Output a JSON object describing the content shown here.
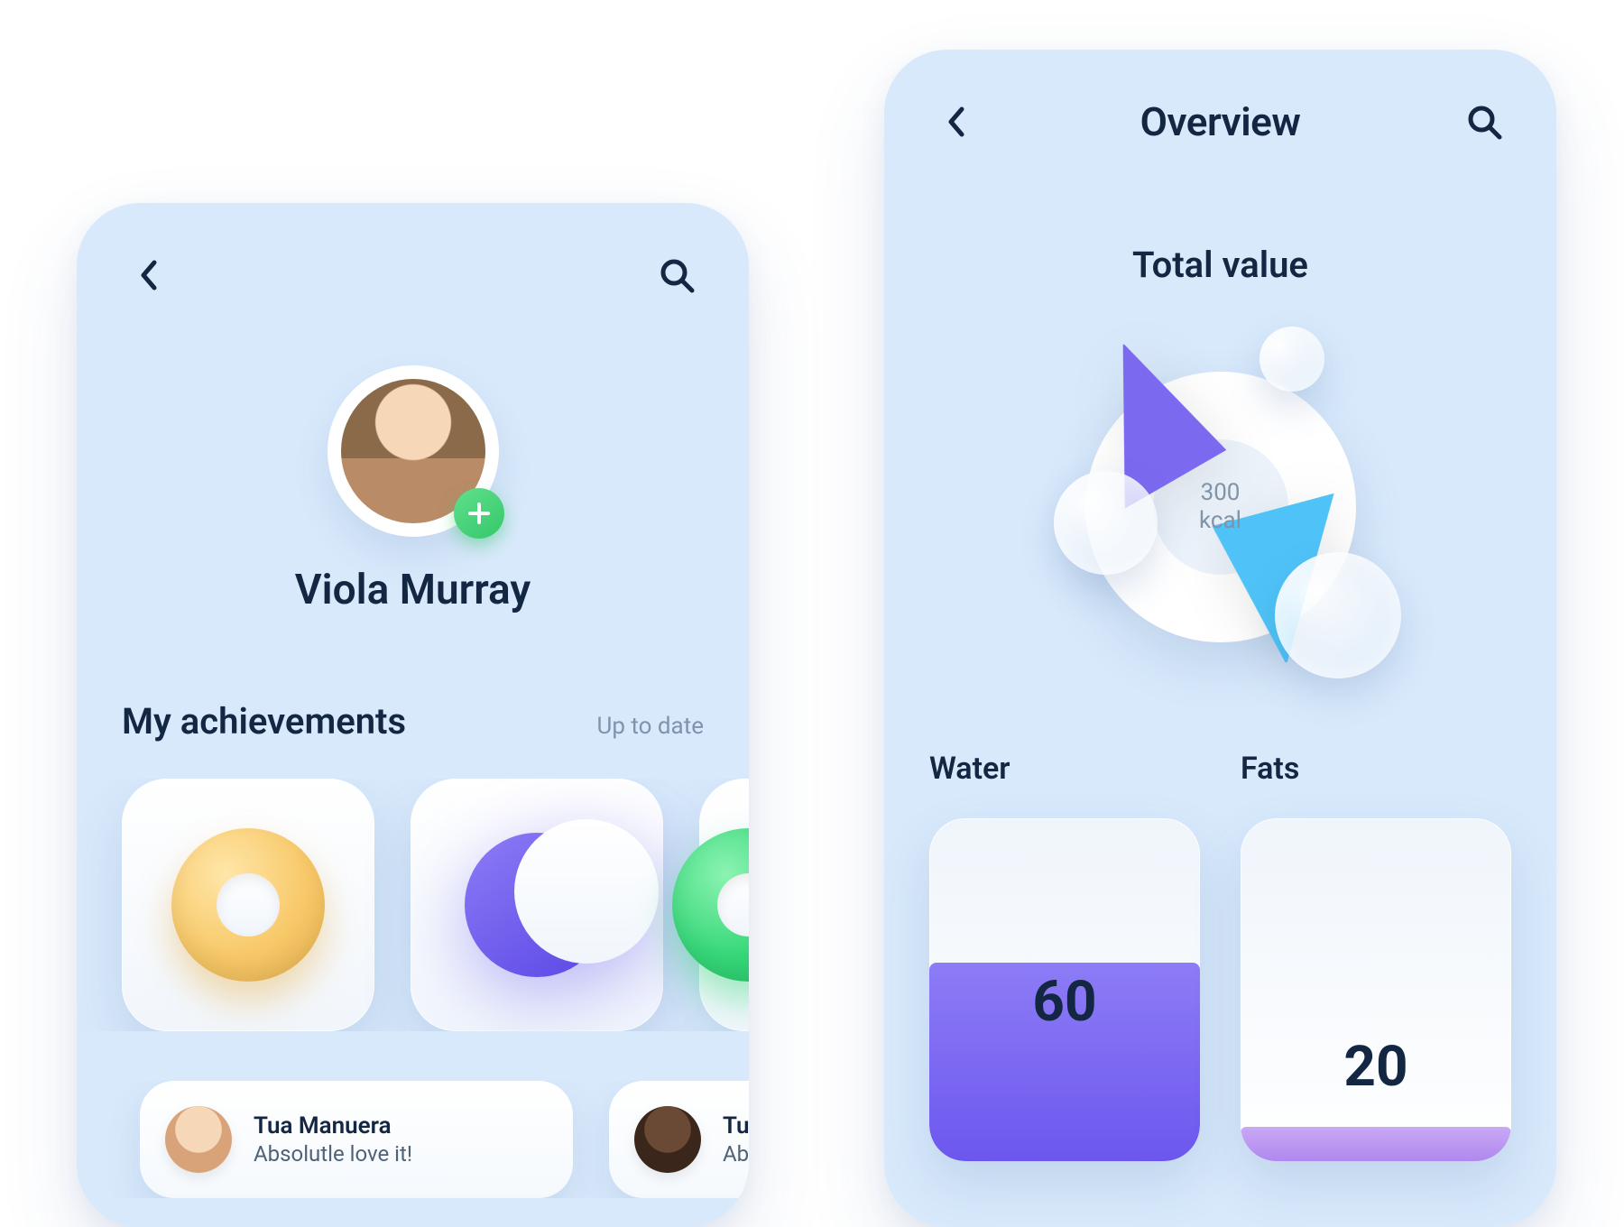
{
  "profile": {
    "name": "Viola Murray",
    "achievements_title": "My achievements",
    "achievements_meta": "Up to date",
    "cards": [
      {
        "icon": "donut-yellow"
      },
      {
        "icon": "moon-purple"
      },
      {
        "icon": "donut-green"
      }
    ],
    "testimonials": [
      {
        "name": "Tua Manuera",
        "text": "Absolutle love it!"
      },
      {
        "name": "Tua",
        "text": "Abso"
      }
    ]
  },
  "overview": {
    "header_title": "Overview",
    "total_title": "Total value",
    "total_value": "300",
    "total_unit": "kcal",
    "stats": [
      {
        "label": "Water",
        "value": 60,
        "fill_pct": 58,
        "color": "purple"
      },
      {
        "label": "Fats",
        "value": 20,
        "fill_pct": 10,
        "color": "pink"
      }
    ]
  },
  "chart_data": {
    "type": "bar",
    "title": "Total value — 300 kcal",
    "categories": [
      "Water",
      "Fats"
    ],
    "values": [
      60,
      20
    ],
    "ylim": [
      0,
      100
    ]
  }
}
